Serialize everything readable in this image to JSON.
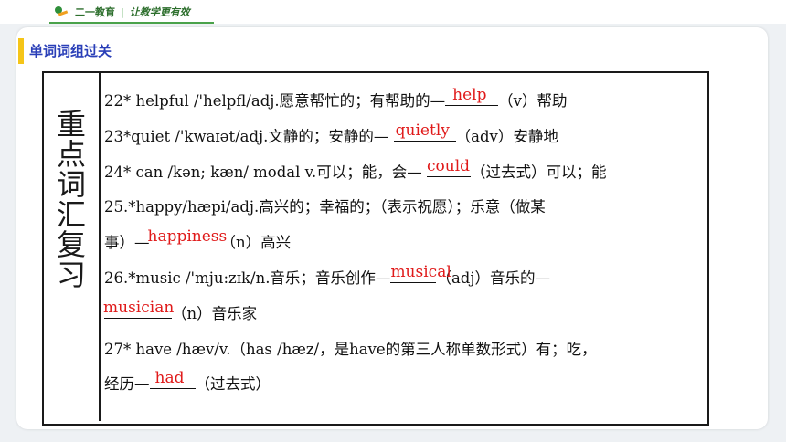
{
  "header": {
    "brand_name": "二一教育",
    "separator": "|",
    "slogan": "让教学更有效"
  },
  "section": {
    "title": "单词词组过关"
  },
  "side_title": [
    "重",
    "点",
    "词",
    "汇",
    "复",
    "习"
  ],
  "lines": {
    "l1_pre": "22* helpful /'helpfl/adj.愿意帮忙的；有帮助的—",
    "l1_ans": "help",
    "l1_post": "（v）帮助",
    "l2_pre": "23*quiet  /'kwaɪət/adj.文静的；安静的— ",
    "l2_ans": "quietly",
    "l2_post": "（adv）安静地",
    "l3_pre": "24* can /kən; kæn/ modal v.可以；能，会— ",
    "l3_ans": "could",
    "l3_post": "（过去式）可以；能",
    "l4": "25.*happy/hæpi/adj.高兴的；幸福的；（表示祝愿）；乐意（做某",
    "l5_pre": "事）—",
    "l5_ans": "happiness",
    "l5_post": "（n）高兴",
    "l6_pre": "26.*music  /'mju:zɪk/n.音乐；音乐创作—",
    "l6_ans": "musical",
    "l6_post": "（adj）音乐的—",
    "l7_ans": "musician",
    "l7_post": "（n）音乐家",
    "l8": "27* have  /hæv/v.（has /hæz/，是have的第三人称单数形式）有；吃，",
    "l9_pre": "经历—",
    "l9_ans": "had",
    "l9_post": "（过去式）"
  },
  "colors": {
    "answer": "#e01a1a",
    "section_title": "#2a3fb8",
    "accent_bar": "#f5c518",
    "brand_green": "#4aa24a"
  }
}
